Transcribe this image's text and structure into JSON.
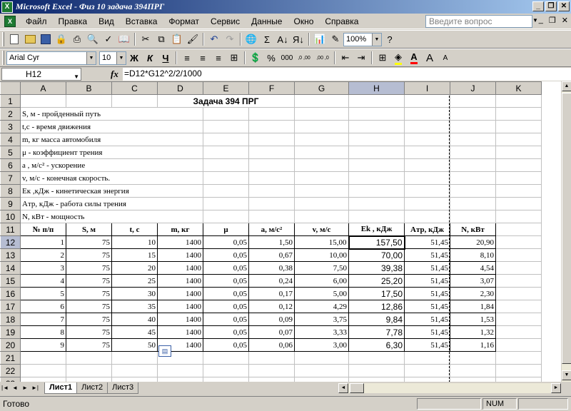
{
  "window": {
    "title": "Microsoft Excel - Физ 10 задача 394ПРГ",
    "app_icon": "X",
    "buttons": [
      "_",
      "❐",
      "✕"
    ]
  },
  "menu": {
    "items": [
      "Файл",
      "Правка",
      "Вид",
      "Вставка",
      "Формат",
      "Сервис",
      "Данные",
      "Окно",
      "Справка"
    ],
    "help_placeholder": "Введите вопрос",
    "doc_buttons": [
      "_",
      "❐",
      "✕"
    ]
  },
  "toolbar": {
    "zoom": "100%",
    "font_name": "Arial Cyr",
    "font_size": "10",
    "bold": "Ж",
    "italic": "К",
    "underline": "Ч",
    "percent": "%",
    "thousands": "000",
    "inc_decimal": ",0 ,00",
    "dec_decimal": ",00 ,0"
  },
  "formula_bar": {
    "name_box": "H12",
    "fx": "fx",
    "formula": "=D12*G12^2/2/1000"
  },
  "grid": {
    "columns": [
      "A",
      "B",
      "C",
      "D",
      "E",
      "F",
      "G",
      "H",
      "I",
      "J",
      "K"
    ],
    "active_column": "H",
    "active_row": "12",
    "title": "Задача 394 ПРГ",
    "notes": [
      "S, м -  пройденный путь",
      "t,с - время движения",
      "m, кг масса автомобиля",
      "μ - коэффициент трения",
      "a , м/с² - ускорение",
      "v, м/с - конечная скорость.",
      "Eк ,кДж - кинетическая энергия",
      "Aтр, кДж - работа силы трения",
      "N, кВт - мощность"
    ],
    "headers": [
      "№ п/п",
      "S, м",
      "t, с",
      "m, кг",
      "μ",
      "a, м/с²",
      "v, м/с",
      "Ek , кДж",
      "Aтр, кДж",
      "N, кВт"
    ],
    "rows": [
      [
        "1",
        "75",
        "10",
        "1400",
        "0,05",
        "1,50",
        "15,00",
        "157,50",
        "51,45",
        "20,90"
      ],
      [
        "2",
        "75",
        "15",
        "1400",
        "0,05",
        "0,67",
        "10,00",
        "70,00",
        "51,45",
        "8,10"
      ],
      [
        "3",
        "75",
        "20",
        "1400",
        "0,05",
        "0,38",
        "7,50",
        "39,38",
        "51,45",
        "4,54"
      ],
      [
        "4",
        "75",
        "25",
        "1400",
        "0,05",
        "0,24",
        "6,00",
        "25,20",
        "51,45",
        "3,07"
      ],
      [
        "5",
        "75",
        "30",
        "1400",
        "0,05",
        "0,17",
        "5,00",
        "17,50",
        "51,45",
        "2,30"
      ],
      [
        "6",
        "75",
        "35",
        "1400",
        "0,05",
        "0,12",
        "4,29",
        "12,86",
        "51,45",
        "1,84"
      ],
      [
        "7",
        "75",
        "40",
        "1400",
        "0,05",
        "0,09",
        "3,75",
        "9,84",
        "51,45",
        "1,53"
      ],
      [
        "8",
        "75",
        "45",
        "1400",
        "0,05",
        "0,07",
        "3,33",
        "7,78",
        "51,45",
        "1,32"
      ],
      [
        "9",
        "75",
        "50",
        "1400",
        "0,05",
        "0,06",
        "3,00",
        "6,30",
        "51,45",
        "1,16"
      ]
    ],
    "row_numbers": [
      "1",
      "2",
      "3",
      "4",
      "5",
      "6",
      "7",
      "8",
      "9",
      "10",
      "11",
      "12",
      "13",
      "14",
      "15",
      "16",
      "17",
      "18",
      "19",
      "20",
      "21",
      "22",
      "23"
    ]
  },
  "sheets": {
    "tabs": [
      "Лист1",
      "Лист2",
      "Лист3"
    ],
    "active": "Лист1"
  },
  "status": {
    "text": "Готово",
    "num": "NUM"
  }
}
